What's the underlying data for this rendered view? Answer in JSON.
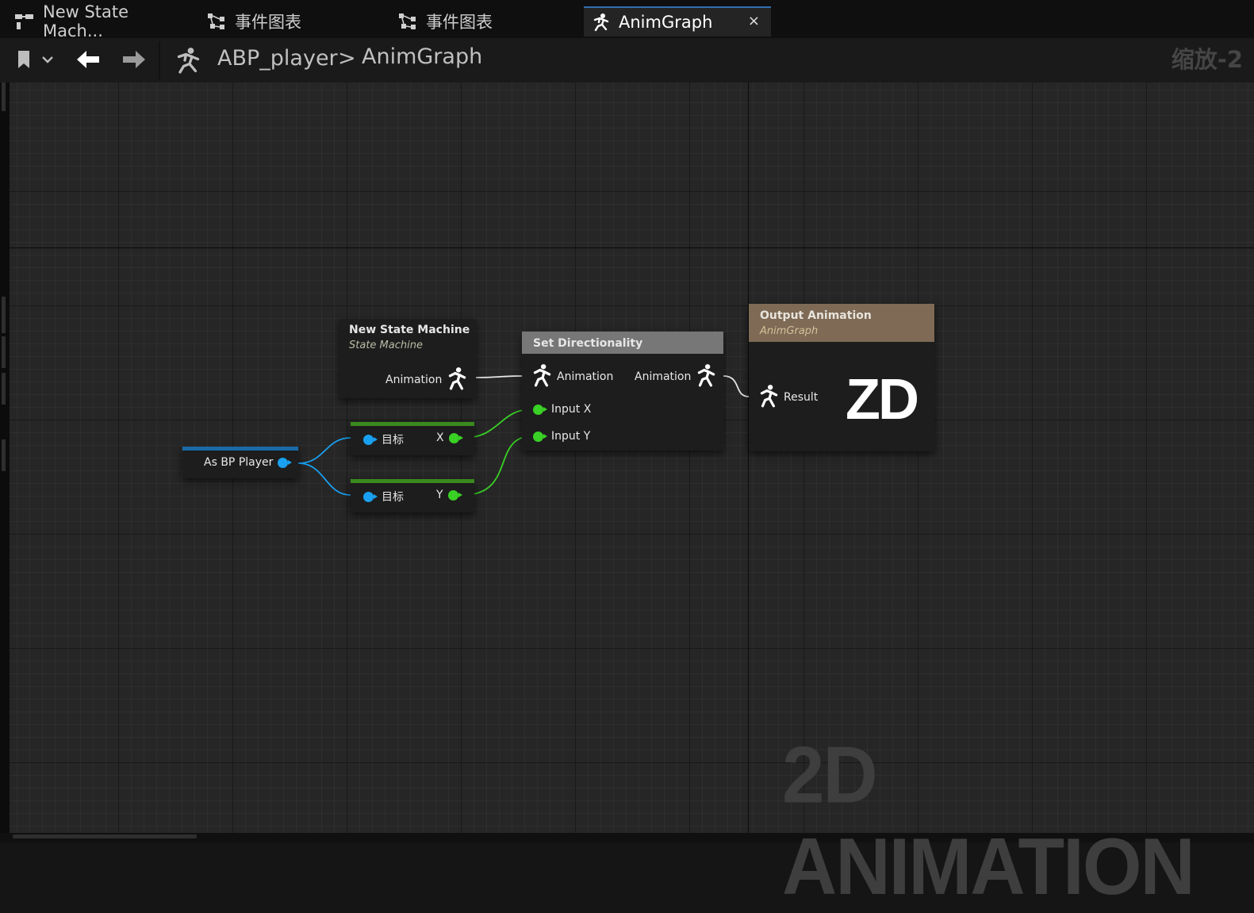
{
  "tabs": [
    {
      "label": "New State Mach...",
      "icon": "state-machine-icon"
    },
    {
      "label": "事件图表",
      "icon": "event-graph-icon"
    },
    {
      "label": "事件图表",
      "icon": "event-graph-icon"
    },
    {
      "label": "AnimGraph",
      "icon": "anim-graph-icon",
      "active": true,
      "close": "×"
    }
  ],
  "toolbar": {
    "breadcrumb": [
      "ABP_player",
      "AnimGraph"
    ],
    "separator": ">",
    "zoom": "缩放-2"
  },
  "nodes": {
    "state_machine": {
      "title": "New State Machine",
      "subtitle": "State Machine",
      "out_pin": "Animation"
    },
    "set_dir": {
      "title": "Set Directionality",
      "in_anim": "Animation",
      "out_anim": "Animation",
      "input_x": "Input X",
      "input_y": "Input Y"
    },
    "output": {
      "title": "Output Animation",
      "subtitle": "AnimGraph",
      "in_pin": "Result",
      "logo": "ZD"
    },
    "cast": {
      "label": "As BP Player"
    },
    "get_x": {
      "target": "目标",
      "out": "X"
    },
    "get_y": {
      "target": "目标",
      "out": "Y"
    }
  },
  "watermark": "2D ANIMATION",
  "colors": {
    "accent_tab": "#2f6fb0",
    "float_pin": "#39d125",
    "object_pin": "#1aa0f0",
    "output_header": "#7e6a55",
    "set_dir_header": "#777777"
  }
}
